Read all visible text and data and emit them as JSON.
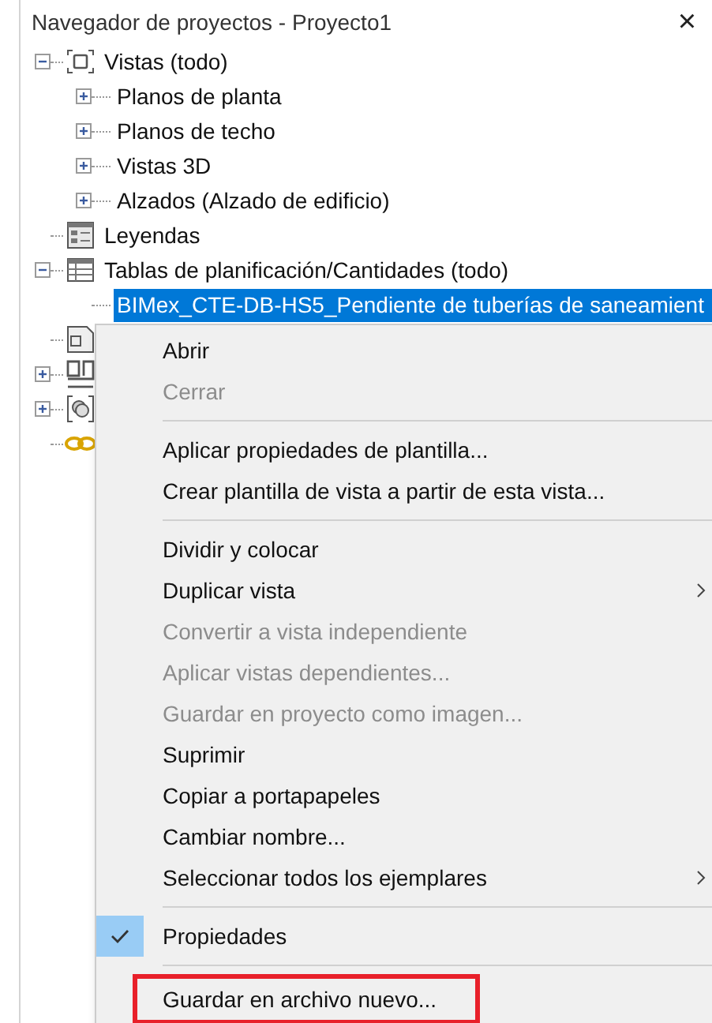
{
  "panel": {
    "title": "Navegador de proyectos - Proyecto1",
    "close": "×"
  },
  "tree": [
    {
      "label": "Vistas (todo)",
      "kind": "views",
      "expanded": true,
      "children": [
        {
          "label": "Planos de planta",
          "expanded": false,
          "selected": false
        },
        {
          "label": "Planos de techo",
          "expanded": false,
          "selected": false
        },
        {
          "label": "Vistas 3D",
          "expanded": false,
          "selected": false
        },
        {
          "label": "Alzados (Alzado de edificio)",
          "expanded": false,
          "selected": false
        }
      ]
    },
    {
      "label": "Leyendas",
      "kind": "legend"
    },
    {
      "label": "Tablas de planificación/Cantidades (todo)",
      "kind": "table",
      "expanded": true,
      "children": [
        {
          "label": "BIMex_CTE-DB-HS5_Pendiente de tuberías de saneamient",
          "selected": true
        }
      ]
    },
    {
      "kind": "sheet"
    },
    {
      "kind": "family",
      "expanded": false
    },
    {
      "kind": "group",
      "expanded": false
    },
    {
      "kind": "link"
    }
  ],
  "context_menu": [
    {
      "kind": "item",
      "label": "Abrir",
      "disabled": false
    },
    {
      "kind": "item",
      "label": "Cerrar",
      "disabled": true
    },
    {
      "kind": "separator"
    },
    {
      "kind": "item",
      "label": "Aplicar propiedades de plantilla...",
      "disabled": false
    },
    {
      "kind": "item",
      "label": "Crear plantilla de vista a partir de esta vista...",
      "disabled": false
    },
    {
      "kind": "separator"
    },
    {
      "kind": "item",
      "label": "Dividir y colocar",
      "disabled": false
    },
    {
      "kind": "item",
      "label": "Duplicar vista",
      "disabled": false,
      "submenu": true
    },
    {
      "kind": "item",
      "label": "Convertir a vista independiente",
      "disabled": true
    },
    {
      "kind": "item",
      "label": "Aplicar vistas dependientes...",
      "disabled": true
    },
    {
      "kind": "item",
      "label": "Guardar en proyecto como imagen...",
      "disabled": true
    },
    {
      "kind": "item",
      "label": "Suprimir",
      "disabled": false
    },
    {
      "kind": "item",
      "label": "Copiar a portapapeles",
      "disabled": false
    },
    {
      "kind": "item",
      "label": "Cambiar nombre...",
      "disabled": false
    },
    {
      "kind": "item",
      "label": "Seleccionar todos los ejemplares",
      "disabled": false,
      "submenu": true
    },
    {
      "kind": "separator"
    },
    {
      "kind": "item",
      "label": "Propiedades",
      "disabled": false,
      "checked": true
    },
    {
      "kind": "separator"
    },
    {
      "kind": "item",
      "label": "Guardar en archivo nuevo...",
      "disabled": false,
      "highlighted": true
    }
  ]
}
